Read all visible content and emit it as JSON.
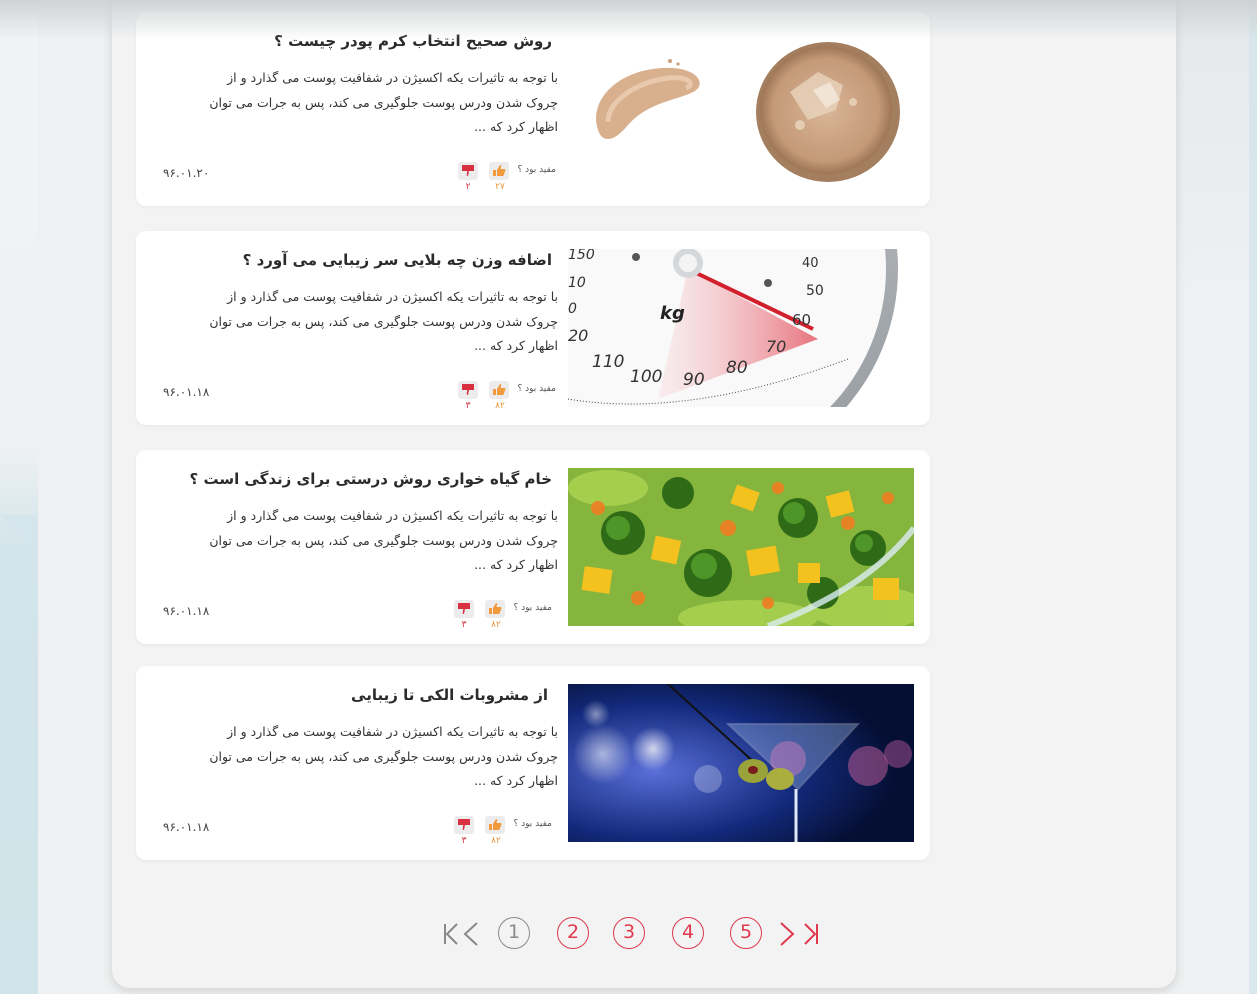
{
  "articles": [
    {
      "title": "روش صحیح انتخاب کرم پودر چیست ؟",
      "excerpt": "با توجه به تاثیرات یکه اکسیژن در شفافیت پوست می گذارد و از چروک شدن ودرس پوست جلوگیری می کند، پس به جرات می توان اظهار کرد که ...",
      "date": "۹۶.۰۱.۲۰",
      "helpful_label": "مفید بود ؟",
      "likes": "۲۷",
      "dislikes": "۲",
      "image": "foundation-powder-image"
    },
    {
      "title": "اضافه وزن چه بلایی سر زیبایی می آورد ؟",
      "excerpt": "با توجه به تاثیرات یکه اکسیژن در شفافیت پوست می گذارد و از چروک شدن ودرس پوست جلوگیری می کند، پس به جرات می توان اظهار کرد که ...",
      "date": "۹۶.۰۱.۱۸",
      "helpful_label": "مفید بود ؟",
      "likes": "۸۲",
      "dislikes": "۳",
      "image": "weight-scale-image",
      "scale_labels": [
        "150",
        "10",
        "0",
        "20",
        "110",
        "100",
        "90",
        "80",
        "70",
        "60",
        "50",
        "40",
        "kg"
      ]
    },
    {
      "title": "خام گیاه خواری روش درستی برای زندگی است ؟",
      "excerpt": "با توجه به تاثیرات یکه اکسیژن در شفافیت پوست می گذارد و از چروک شدن ودرس پوست جلوگیری می کند، پس به جرات می توان اظهار کرد که ...",
      "date": "۹۶.۰۱.۱۸",
      "helpful_label": "مفید بود ؟",
      "likes": "۸۲",
      "dislikes": "۳",
      "image": "vegetable-salad-image"
    },
    {
      "title": "از مشروبات الکی تا زیبایی",
      "excerpt": "با توجه به تاثیرات یکه اکسیژن در شفافیت پوست می گذارد و از چروک شدن ودرس پوست جلوگیری می کند، پس به جرات می توان اظهار کرد که ...",
      "date": "۹۶.۰۱.۱۸",
      "helpful_label": "مفید بود ؟",
      "likes": "۸۲",
      "dislikes": "۳",
      "image": "martini-glass-image"
    }
  ],
  "pagination": {
    "pages": [
      "1",
      "2",
      "3",
      "4",
      "5"
    ],
    "current": "1",
    "icons": [
      "first-page-icon",
      "prev-page-icon",
      "next-page-icon",
      "last-page-icon"
    ]
  },
  "colors": {
    "accent_red": "#e0394e",
    "like_orange": "#f29a3b",
    "dislike_red": "#d9303f",
    "card_bg": "#ffffff",
    "panel_bg": "#f3f3f4"
  }
}
